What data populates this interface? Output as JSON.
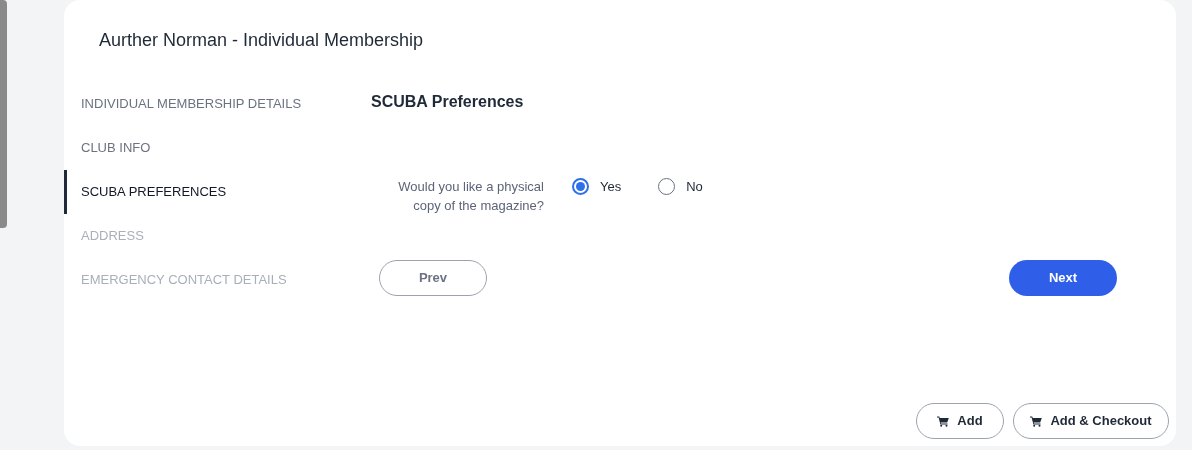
{
  "title": "Aurther Norman - Individual Membership",
  "steps": [
    {
      "label": "INDIVIDUAL MEMBERSHIP DETAILS",
      "selected": false,
      "disabled": false
    },
    {
      "label": "CLUB INFO",
      "selected": false,
      "disabled": false
    },
    {
      "label": "SCUBA PREFERENCES",
      "selected": true,
      "disabled": false
    },
    {
      "label": "ADDRESS",
      "selected": false,
      "disabled": true
    },
    {
      "label": "EMERGENCY CONTACT DETAILS",
      "selected": false,
      "disabled": true
    }
  ],
  "section": {
    "heading": "SCUBA Preferences",
    "question": "Would you like a physical copy of the magazine?",
    "options": [
      {
        "label": "Yes",
        "selected": true
      },
      {
        "label": "No",
        "selected": false
      }
    ]
  },
  "nav": {
    "prev": "Prev",
    "next": "Next"
  },
  "actions": [
    "Add",
    "Add & Checkout"
  ]
}
